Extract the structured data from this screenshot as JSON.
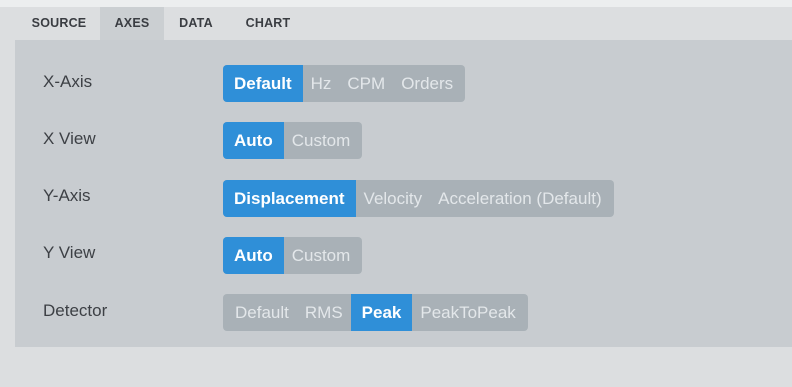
{
  "tabs": [
    {
      "label": "SOURCE",
      "active": false
    },
    {
      "label": "AXES",
      "active": true
    },
    {
      "label": "DATA",
      "active": false
    },
    {
      "label": "CHART",
      "active": false
    }
  ],
  "rows": [
    {
      "label": "X-Axis",
      "options": [
        "Default",
        "Hz",
        "CPM",
        "Orders"
      ],
      "selected": "Default"
    },
    {
      "label": "X View",
      "options": [
        "Auto",
        "Custom"
      ],
      "selected": "Auto"
    },
    {
      "label": "Y-Axis",
      "options": [
        "Displacement",
        "Velocity",
        "Acceleration (Default)"
      ],
      "selected": "Displacement"
    },
    {
      "label": "Y View",
      "options": [
        "Auto",
        "Custom"
      ],
      "selected": "Auto"
    },
    {
      "label": "Detector",
      "options": [
        "Default",
        "RMS",
        "Peak",
        "PeakToPeak"
      ],
      "selected": "Peak"
    }
  ],
  "colors": {
    "accent": "#2f8fd8",
    "segment_bg": "#a9b1b7",
    "panel_bg": "#c8ccd0"
  }
}
